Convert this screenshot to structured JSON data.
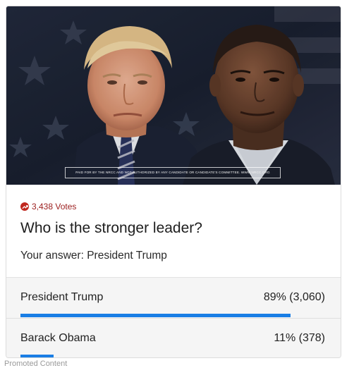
{
  "hero": {
    "disclaimer": "PAID FOR BY THE NRCC AND NOT AUTHORIZED BY ANY CANDIDATE OR CANDIDATE'S COMMITTEE. WWW.NRCC.ORG"
  },
  "poll": {
    "votes_icon": "trending-up-icon",
    "votes_label": "3,438 Votes",
    "question": "Who is the stronger leader?",
    "your_answer": "Your answer: President Trump",
    "options": [
      {
        "label": "President Trump",
        "stat": "89% (3,060)",
        "share": 0.89
      },
      {
        "label": "Barack Obama",
        "stat": "11% (378)",
        "share": 0.11
      }
    ]
  },
  "footer": {
    "promoted": "Promoted Content"
  },
  "colors": {
    "accent_bar": "#1a7ee5",
    "votes_red": "#9b1d1d"
  }
}
